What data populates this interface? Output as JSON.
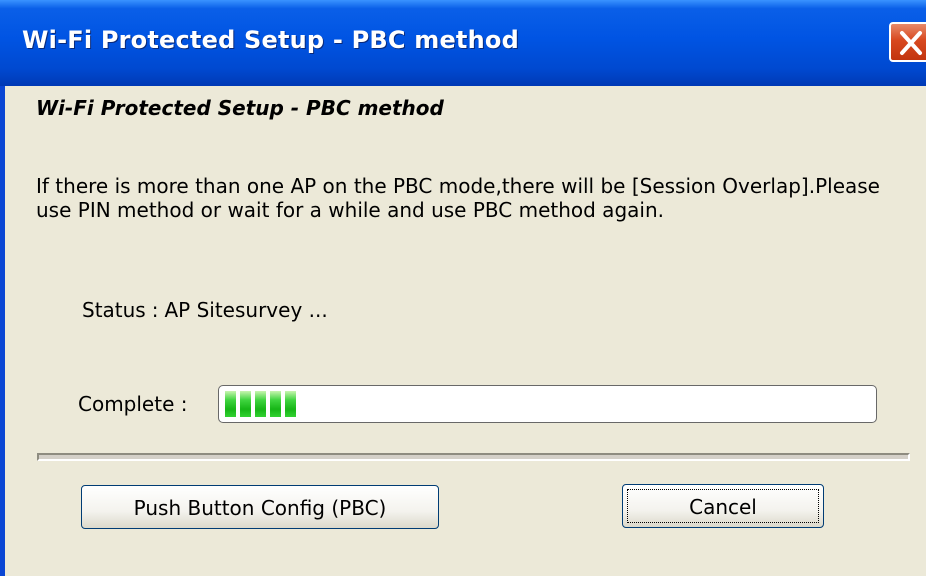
{
  "window": {
    "title": "Wi-Fi Protected Setup - PBC method"
  },
  "content": {
    "heading": "Wi-Fi Protected Setup - PBC method",
    "description": "If there is more than one AP on the PBC mode,there will be [Session Overlap].Please use PIN method or wait for a while and use PBC method again.",
    "status_label": "Status",
    "status_separator": ":",
    "status_value": "AP Sitesurvey ...",
    "complete_label": "Complete :",
    "progress_percent": 10,
    "progress_chunk_color": "#22c022"
  },
  "buttons": {
    "pbc_label": "Push Button Config (PBC)",
    "cancel_label": "Cancel"
  },
  "colors": {
    "titlebar": "#0054e3",
    "close_button": "#d8481f",
    "dialog_background": "#ece9d8"
  },
  "icons": {
    "close": "close-icon"
  }
}
